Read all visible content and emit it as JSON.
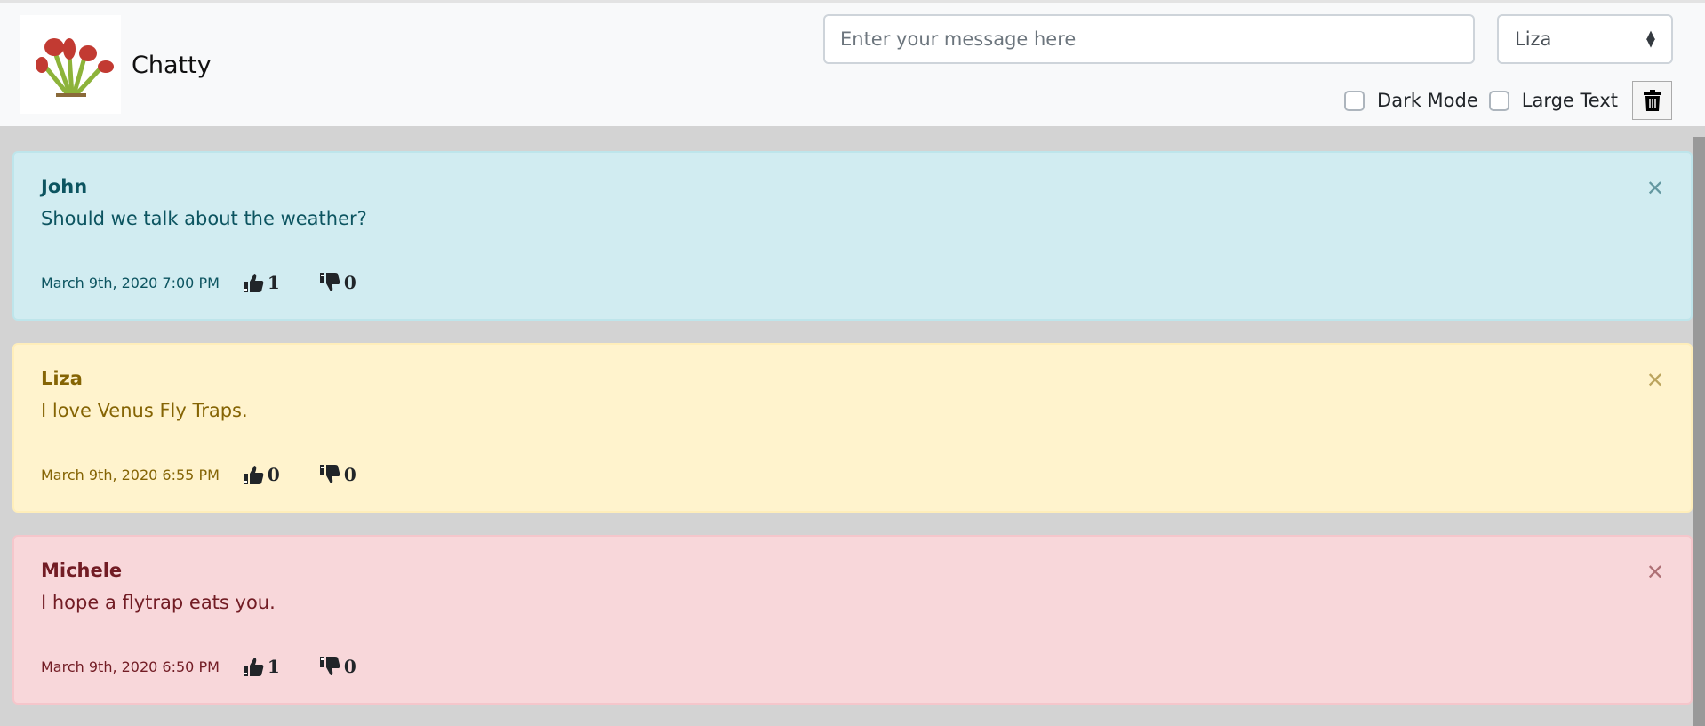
{
  "header": {
    "brand": "Chatty",
    "message_placeholder": "Enter your message here",
    "user_select": "Liza",
    "dark_mode_label": "Dark Mode",
    "large_text_label": "Large Text",
    "dark_mode_checked": false,
    "large_text_checked": false
  },
  "messages": [
    {
      "author": "John",
      "text": "Should we talk about the weather?",
      "timestamp": "March 9th, 2020 7:00 PM",
      "likes": "1",
      "dislikes": "0",
      "variant": "info",
      "bg": "#d1ecf1",
      "fg": "#0c5460",
      "border": "#bee5eb"
    },
    {
      "author": "Liza",
      "text": "I love Venus Fly Traps.",
      "timestamp": "March 9th, 2020 6:55 PM",
      "likes": "0",
      "dislikes": "0",
      "variant": "warning",
      "bg": "#fff3cd",
      "fg": "#856404",
      "border": "#ffeeba"
    },
    {
      "author": "Michele",
      "text": "I hope a flytrap eats you.",
      "timestamp": "March 9th, 2020 6:50 PM",
      "likes": "1",
      "dislikes": "0",
      "variant": "danger",
      "bg": "#f8d7da",
      "fg": "#721c24",
      "border": "#f5c6cb"
    }
  ]
}
